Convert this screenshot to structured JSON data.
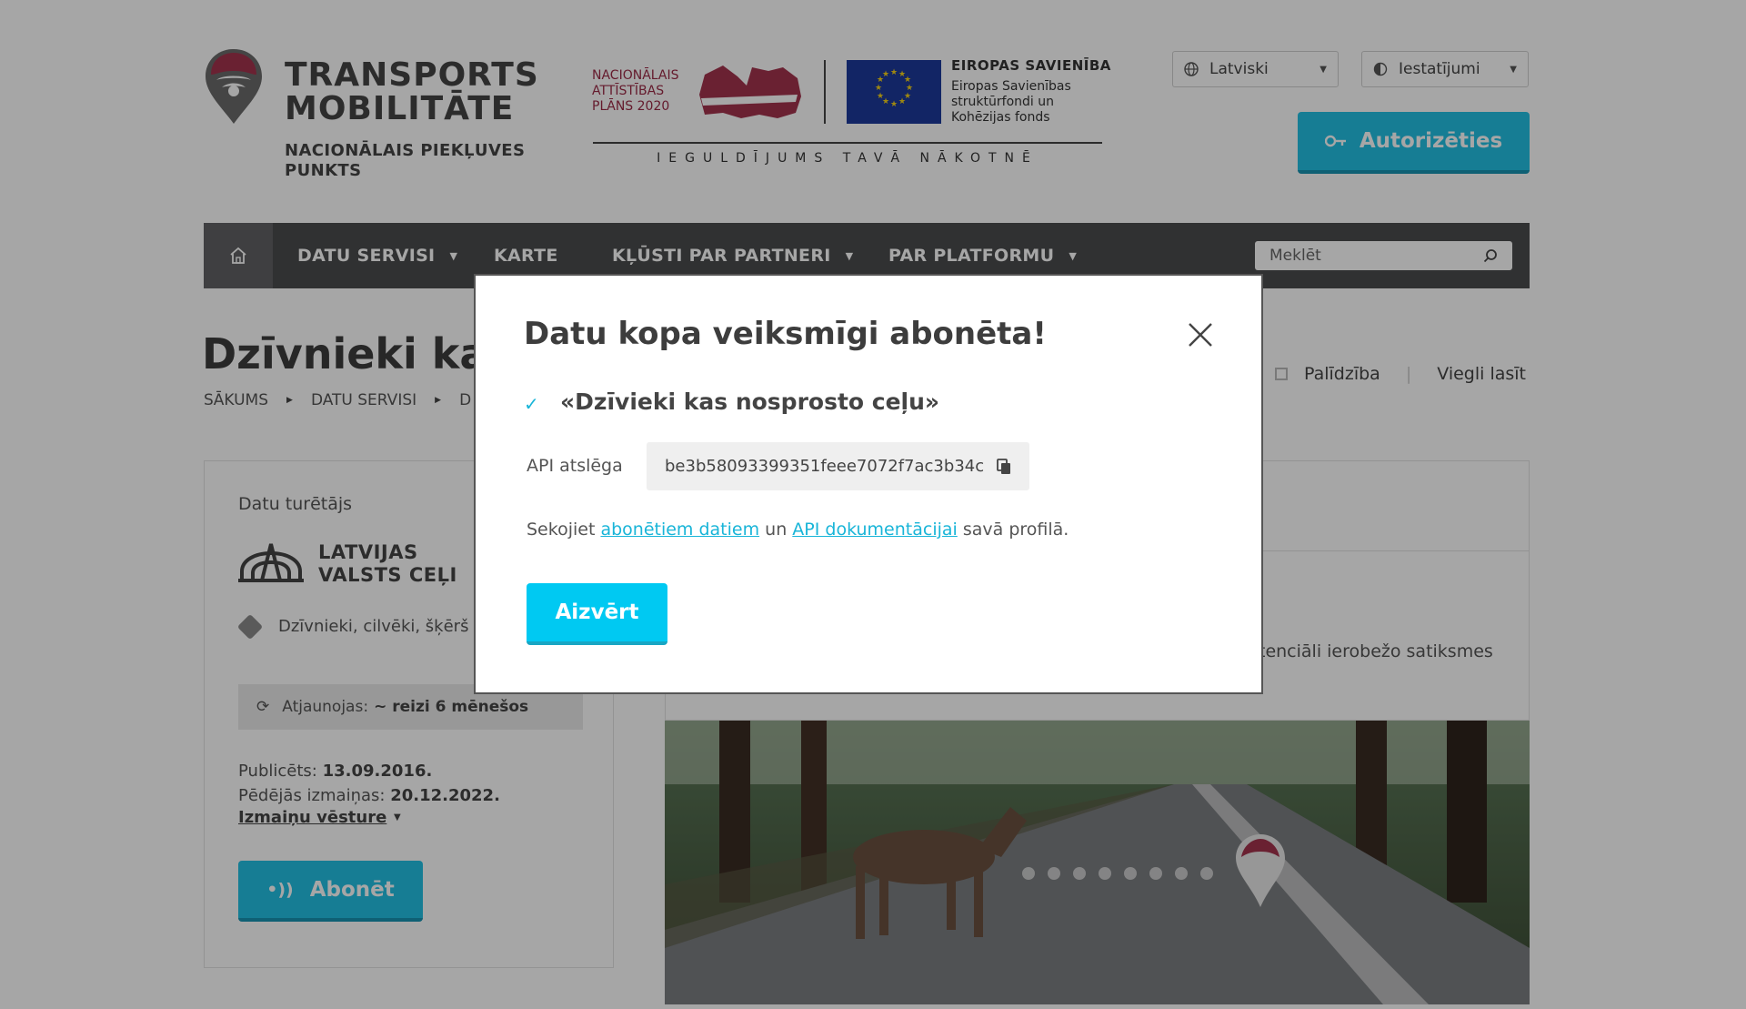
{
  "header": {
    "brand_line1": "TRANSPORTS",
    "brand_line2": "MOBILITĀTE",
    "brand_sub": "NACIONĀLAIS PIEKĻUVES PUNKTS",
    "nap_line1": "NACIONĀLAIS",
    "nap_line2": "ATTĪSTĪBAS",
    "nap_line3": "PLĀNS 2020",
    "eu_title": "EIROPAS SAVIENĪBA",
    "eu_sub": "Eiropas Savienības struktūrfondi un Kohēzijas fonds",
    "eu_motto": "IEGULDĪJUMS TAVĀ NĀKOTNĒ",
    "language_select": "Latviski",
    "settings_select": "Iestatījumi",
    "auth_button": "Autorizēties"
  },
  "nav": {
    "items": [
      {
        "label": "DATU SERVISI"
      },
      {
        "label": "KARTE"
      },
      {
        "label": "KĻŪSTI PAR PARTNERI"
      },
      {
        "label": "PAR PLATFORMU"
      }
    ],
    "search_placeholder": "Meklēt"
  },
  "page": {
    "title": "Dzīvnieki kas",
    "breadcrumbs": [
      "SĀKUMS",
      "DATU SERVISI",
      "D"
    ],
    "help": "Palīdzība",
    "easy_read": "Viegli lasīt",
    "description_fragment": "tenciāli ierobežo satiksmes"
  },
  "info": {
    "holder_label": "Datu turētājs",
    "holder_name_line1": "LATVIJAS",
    "holder_name_line2": "VALSTS CEĻI",
    "category": "Dzīvnieki, cilvēki, šķērš uz ceļa",
    "updates_label": "Atjaunojas:",
    "updates_value": "~ reizi 6 mēnešos",
    "published_label": "Publicēts:",
    "published_value": "13.09.2016.",
    "changed_label": "Pēdējās izmaiņas:",
    "changed_value": "20.12.2022.",
    "history_link": "Izmaiņu vēsture",
    "subscribe_button": "Abonēt"
  },
  "modal": {
    "title": "Datu kopa veiksmīgi abonēta!",
    "dataset_name": "«Dzīvieki kas nosprosto ceļu»",
    "api_label": "API atslēga",
    "api_key": "be3b580933993​51feee7072f7ac3b34c",
    "follow_prefix": "Sekojiet",
    "follow_link1": "abonētiem datiem",
    "follow_middle": "un",
    "follow_link2": "API dokumentācijai",
    "follow_suffix": "savā profilā.",
    "close_button": "Aizvērt"
  },
  "colors": {
    "accent": "#23c1e4",
    "modal_button": "#00c9f2",
    "nav_bg": "#4b4c4e",
    "brand_red": "#9b2a46",
    "eu_blue": "#1d3a9b"
  }
}
